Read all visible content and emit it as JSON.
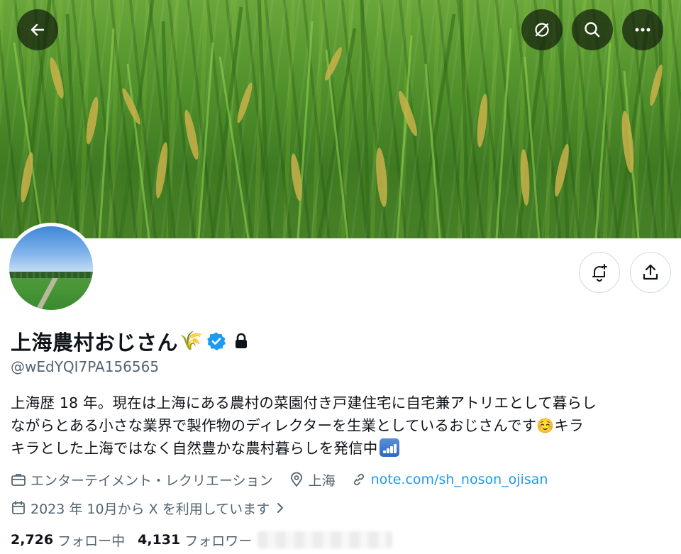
{
  "header": {
    "back_icon": "arrow-left-icon",
    "grok_icon": "grok-icon",
    "search_icon": "search-icon",
    "more_icon": "more-dots-icon"
  },
  "profile": {
    "display_name": "上海農村おじさん",
    "name_emoji": "🌾",
    "verified_icon": "verified-badge-icon",
    "protected_icon": "lock-icon",
    "handle": "@wEdYQI7PA156565",
    "bio_line1": "上海歴 18 年。現在は上海にある農村の菜園付き戸建住宅に自宅兼アトリエとして暮らし",
    "bio_line2": "ながらとある小さな業界で製作物のディレクターを生業としているおじさんです",
    "bio_emoji_smile": "☺️",
    "bio_line2_tail": "キラ",
    "bio_line3": "キラとした上海ではなく自然豊かな農村暮らしを発信中",
    "category": "エンターテイメント・レクリエーション",
    "location": "上海",
    "website": "note.com/sh_noson_ojisan",
    "joined": "2023 年 10月から X を利用しています",
    "following_count": "2,726",
    "following_label": "フォロー中",
    "followers_count": "4,131",
    "followers_label": "フォロワー"
  },
  "actions": {
    "notify_icon": "bell-plus-icon",
    "share_icon": "share-icon"
  },
  "colors": {
    "link": "#1d9bf0",
    "verified": "#1d9bf0",
    "secondary_text": "#536471"
  }
}
